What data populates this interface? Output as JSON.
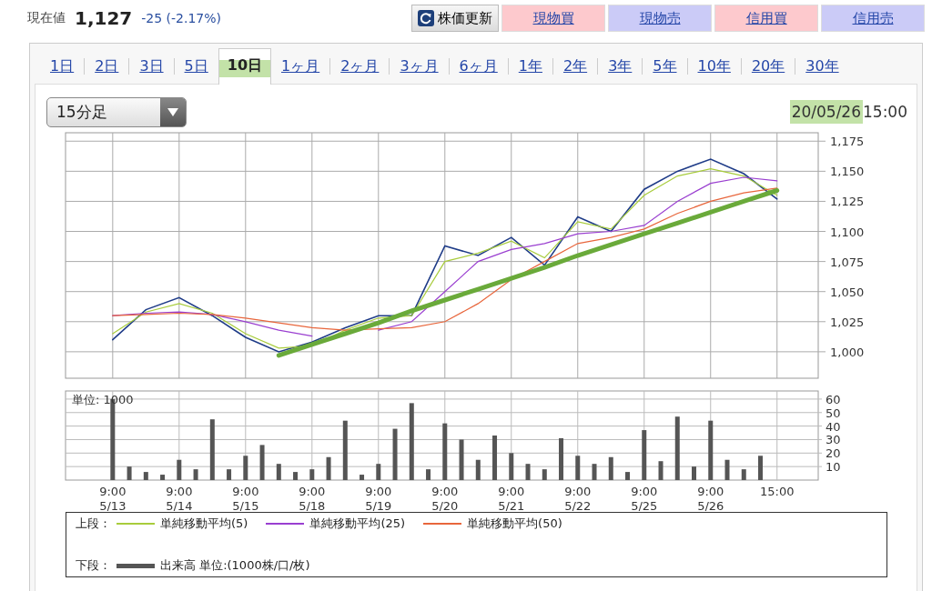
{
  "quote": {
    "label": "現在値",
    "price": "1,127",
    "change": "-25 (-2.17%)"
  },
  "buttons": [
    {
      "label": "株価更新",
      "kind": "refresh"
    },
    {
      "label": "現物買",
      "kind": "trade",
      "color": "#fdc9cd"
    },
    {
      "label": "現物売",
      "kind": "trade",
      "color": "#cbcbf7"
    },
    {
      "label": "信用買",
      "kind": "trade",
      "color": "#fdc9cd"
    },
    {
      "label": "信用売",
      "kind": "trade",
      "color": "#cbcbf7"
    }
  ],
  "tabs": [
    {
      "label": "1日",
      "selected": false,
      "highlighted": false
    },
    {
      "label": "2日",
      "selected": false,
      "highlighted": false
    },
    {
      "label": "3日",
      "selected": false,
      "highlighted": false
    },
    {
      "label": "5日",
      "selected": false,
      "highlighted": false
    },
    {
      "label": "10日",
      "selected": true,
      "highlighted": true
    },
    {
      "label": "1ヶ月",
      "selected": false,
      "highlighted": false
    },
    {
      "label": "2ヶ月",
      "selected": false,
      "highlighted": false
    },
    {
      "label": "3ヶ月",
      "selected": false,
      "highlighted": false
    },
    {
      "label": "6ヶ月",
      "selected": false,
      "highlighted": false
    },
    {
      "label": "1年",
      "selected": false,
      "highlighted": false
    },
    {
      "label": "2年",
      "selected": false,
      "highlighted": false
    },
    {
      "label": "3年",
      "selected": false,
      "highlighted": false
    },
    {
      "label": "5年",
      "selected": false,
      "highlighted": false
    },
    {
      "label": "10年",
      "selected": false,
      "highlighted": false
    },
    {
      "label": "20年",
      "selected": false,
      "highlighted": false
    },
    {
      "label": "30年",
      "selected": false,
      "highlighted": false
    }
  ],
  "interval_select": {
    "value": "15分足"
  },
  "timestamp": {
    "date": "20/05/26",
    "time": "15:00",
    "highlighted": true
  },
  "price_chart": {
    "chart_data": {
      "type": "line",
      "grid": true,
      "ylim": [
        978,
        1182
      ],
      "yticks": [
        {
          "value": 1000,
          "label": "1,000"
        },
        {
          "value": 1025,
          "label": "1,025"
        },
        {
          "value": 1050,
          "label": "1,050"
        },
        {
          "value": 1075,
          "label": "1,075"
        },
        {
          "value": 1100,
          "label": "1,100"
        },
        {
          "value": 1125,
          "label": "1,125"
        },
        {
          "value": 1150,
          "label": "1,150"
        },
        {
          "value": 1175,
          "label": "1,175"
        }
      ],
      "categories": [
        null,
        null,
        null,
        null,
        null,
        null,
        null,
        null,
        null,
        null,
        null,
        null,
        null,
        null,
        null,
        null,
        null,
        null,
        null,
        null,
        null
      ],
      "series": [
        {
          "color": "#1f3c88",
          "values": [
            1010,
            1035,
            1045,
            1030,
            1012,
            1000,
            1008,
            1020,
            1030,
            1030,
            1088,
            1080,
            1095,
            1072,
            1112,
            1100,
            1135,
            1150,
            1160,
            1148,
            1127
          ]
        },
        {
          "name": "単純移動平均(5)",
          "color": "#a8cc3c",
          "values": [
            1015,
            1033,
            1040,
            1032,
            1015,
            1003,
            1005,
            1018,
            1028,
            1030,
            1075,
            1082,
            1092,
            1078,
            1108,
            1102,
            1130,
            1146,
            1152,
            1146,
            1130
          ]
        },
        {
          "name": "単純移動平均(25)",
          "color": "#9a3fd0",
          "values": [
            1030,
            1032,
            1033,
            1031,
            1025,
            1018,
            1013,
            null,
            1018,
            1025,
            1050,
            1075,
            1085,
            1090,
            1098,
            1100,
            1105,
            1125,
            1140,
            1145,
            1142
          ]
        },
        {
          "name": "単純移動平均(50)",
          "color": "#e8663c",
          "values": [
            1030,
            1031,
            1032,
            1031,
            1028,
            1024,
            1020,
            1018,
            1019,
            1020,
            1025,
            1040,
            1060,
            1075,
            1090,
            1095,
            1102,
            1115,
            1125,
            1132,
            1136
          ]
        },
        {
          "color": "#6aaa3a",
          "values": [
            null,
            null,
            null,
            null,
            null,
            997,
            1006,
            1015,
            1024,
            1034,
            1043,
            1052,
            1061,
            1070,
            1080,
            1089,
            1098,
            1107,
            1116,
            1125,
            1134
          ]
        }
      ]
    }
  },
  "volume_chart": {
    "chart_data": {
      "type": "bar",
      "grid": true,
      "ylabel": "単位: 1000",
      "ylim": [
        0,
        66
      ],
      "categories": [
        "9:00\n5/13",
        null,
        null,
        null,
        "9:00\n5/14",
        null,
        null,
        null,
        "9:00\n5/15",
        null,
        null,
        null,
        "9:00\n5/18",
        null,
        null,
        null,
        "9:00\n5/19",
        null,
        null,
        null,
        "9:00\n5/20",
        null,
        null,
        null,
        "9:00\n5/21",
        null,
        null,
        null,
        "9:00\n5/22",
        null,
        null,
        null,
        "9:00\n5/25",
        null,
        null,
        null,
        "9:00\n5/26",
        null,
        null,
        null,
        "15:00"
      ],
      "yticks": [
        10,
        20,
        30,
        40,
        50,
        60
      ],
      "series": [
        {
          "name": "出来高 単位:(1000株/口/枚)",
          "color": "#555555",
          "values": [
            60,
            10,
            6,
            4,
            15,
            8,
            45,
            8,
            18,
            26,
            12,
            6,
            8,
            17,
            44,
            4,
            12,
            38,
            57,
            8,
            42,
            30,
            15,
            33,
            20,
            12,
            8,
            31,
            18,
            12,
            17,
            6,
            37,
            14,
            47,
            10,
            44,
            15,
            8,
            18,
            null
          ]
        }
      ]
    }
  },
  "legend": {
    "upper_label": "上段：",
    "lower_label": "下段："
  }
}
